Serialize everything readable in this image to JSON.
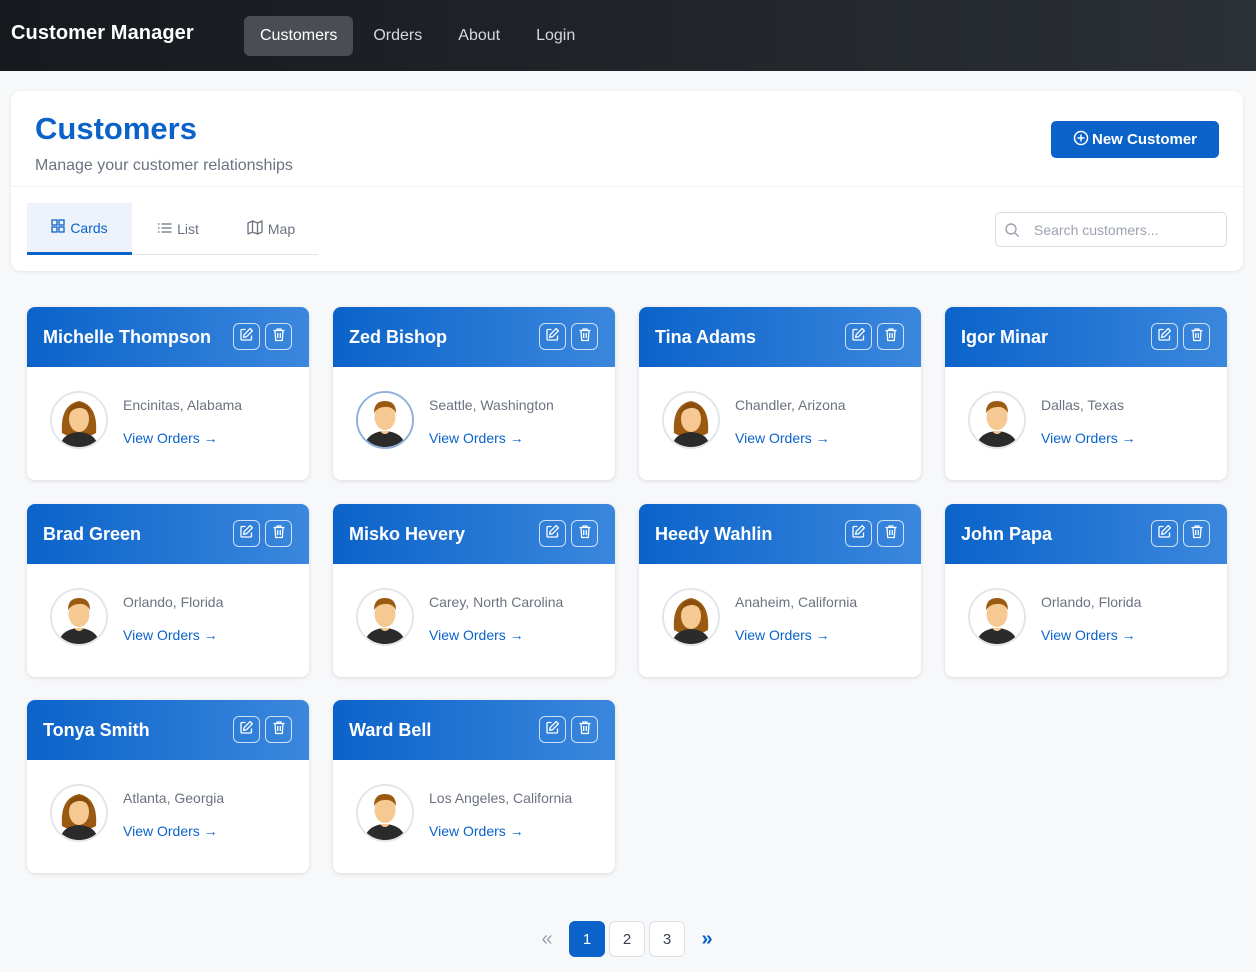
{
  "app": {
    "title": "Customer Manager"
  },
  "nav": {
    "items": [
      {
        "label": "Customers",
        "active": true
      },
      {
        "label": "Orders",
        "active": false
      },
      {
        "label": "About",
        "active": false
      },
      {
        "label": "Login",
        "active": false
      }
    ]
  },
  "page": {
    "title": "Customers",
    "subtitle": "Manage your customer relationships",
    "new_button": "New Customer"
  },
  "tabs": {
    "cards": "Cards",
    "list": "List",
    "map": "Map",
    "active": "Cards"
  },
  "search": {
    "placeholder": "Search customers..."
  },
  "customers": [
    {
      "name": "Michelle Thompson",
      "location": "Encinitas, Alabama",
      "gender": "female",
      "link": "View Orders →"
    },
    {
      "name": "Zed Bishop",
      "location": "Seattle, Washington",
      "gender": "male",
      "link": "View Orders →"
    },
    {
      "name": "Tina Adams",
      "location": "Chandler, Arizona",
      "gender": "female",
      "link": "View Orders →"
    },
    {
      "name": "Igor Minar",
      "location": "Dallas, Texas",
      "gender": "male",
      "link": "View Orders →"
    },
    {
      "name": "Brad Green",
      "location": "Orlando, Florida",
      "gender": "male",
      "link": "View Orders →"
    },
    {
      "name": "Misko Hevery",
      "location": "Carey, North Carolina",
      "gender": "male",
      "link": "View Orders →"
    },
    {
      "name": "Heedy Wahlin",
      "location": "Anaheim, California",
      "gender": "female",
      "link": "View Orders →"
    },
    {
      "name": "John Papa",
      "location": "Orlando, Florida",
      "gender": "male",
      "link": "View Orders →"
    },
    {
      "name": "Tonya Smith",
      "location": "Atlanta, Georgia",
      "gender": "female",
      "link": "View Orders →"
    },
    {
      "name": "Ward Bell",
      "location": "Los Angeles, California",
      "gender": "male",
      "link": "View Orders →"
    }
  ],
  "pagination": {
    "prev": "«",
    "pages": [
      "1",
      "2",
      "3"
    ],
    "current": "1",
    "next": "»"
  },
  "colors": {
    "accent": "#0b63c9",
    "navbar": "#1e2227",
    "background": "#f7f8fa"
  }
}
